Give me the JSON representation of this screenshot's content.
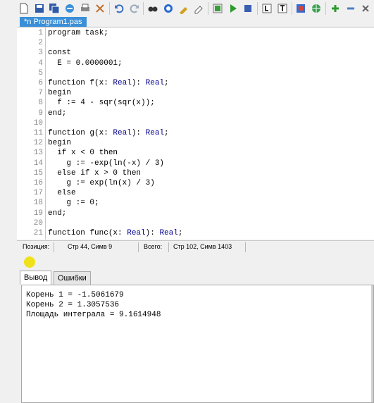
{
  "toolbar": {
    "icons": [
      "new-file-icon",
      "save-icon",
      "save-all-icon",
      "open-icon",
      "print-icon",
      "cut-icon",
      "undo-icon",
      "redo-icon",
      "find-icon",
      "replace-icon",
      "format-icon",
      "clear-icon",
      "compile-icon",
      "run-icon",
      "stop-icon",
      "step-into-icon",
      "step-over-icon",
      "debug-icon",
      "web-icon",
      "add-watch-icon",
      "remove-watch-icon"
    ]
  },
  "tab": {
    "label": "*n Program1.pas"
  },
  "editor": {
    "lines": [
      {
        "n": "1",
        "text": "program task;"
      },
      {
        "n": "2",
        "text": ""
      },
      {
        "n": "3",
        "text": "const"
      },
      {
        "n": "4",
        "text": "  E = 0.0000001;"
      },
      {
        "n": "5",
        "text": ""
      },
      {
        "n": "6",
        "text": "function f(x: Real): Real;"
      },
      {
        "n": "7",
        "text": "begin"
      },
      {
        "n": "8",
        "text": "  f := 4 - sqr(sqr(x));"
      },
      {
        "n": "9",
        "text": "end;"
      },
      {
        "n": "10",
        "text": ""
      },
      {
        "n": "11",
        "text": "function g(x: Real): Real;"
      },
      {
        "n": "12",
        "text": "begin"
      },
      {
        "n": "13",
        "text": "  if x < 0 then"
      },
      {
        "n": "14",
        "text": "    g := -exp(ln(-x) / 3)"
      },
      {
        "n": "15",
        "text": "  else if x > 0 then"
      },
      {
        "n": "16",
        "text": "    g := exp(ln(x) / 3)"
      },
      {
        "n": "17",
        "text": "  else"
      },
      {
        "n": "18",
        "text": "    g := 0;"
      },
      {
        "n": "19",
        "text": "end;"
      },
      {
        "n": "20",
        "text": ""
      },
      {
        "n": "21",
        "text": "function func(x: Real): Real;"
      }
    ]
  },
  "status": {
    "position_label": "Позиция:",
    "position_value": "Стр 44, Симв 9",
    "total_label": "Всего:",
    "total_value": "Стр 102, Симв 1403"
  },
  "output_tabs": {
    "output": "Вывод",
    "errors": "Ошибки"
  },
  "output": {
    "lines": [
      "Корень 1 = -1.5061679",
      "Корень 2 = 1.3057536",
      "Площадь интеграла = 9.1614948"
    ]
  },
  "colors": {
    "tab_active": "#3a8fd8",
    "keyword_type": "#00008b",
    "marker": "#f0e21a"
  }
}
